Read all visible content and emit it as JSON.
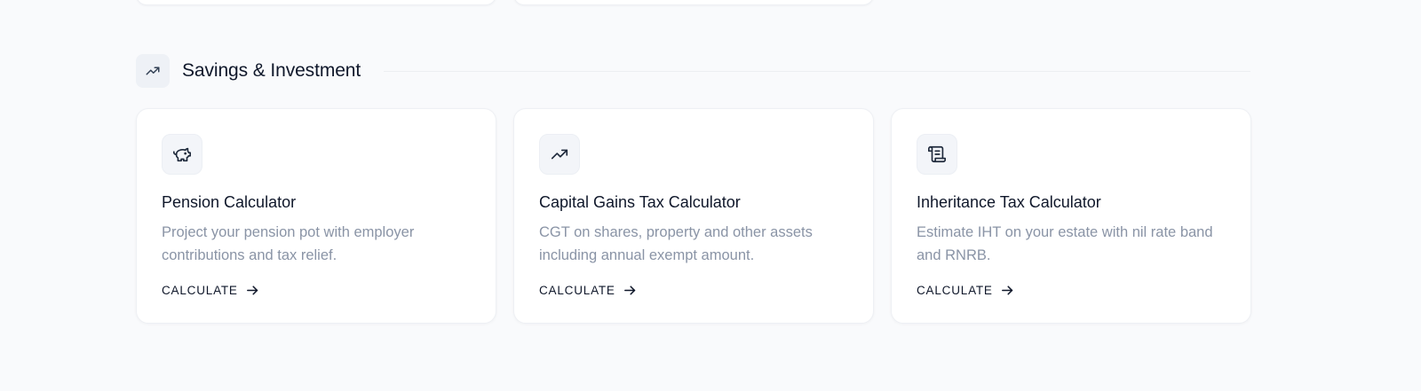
{
  "section": {
    "title": "Savings & Investment",
    "icon": "trending-up-icon"
  },
  "cards": [
    {
      "title": "Pension Calculator",
      "description": "Project your pension pot with employer contributions and tax relief.",
      "cta": "CALCULATE",
      "icon": "piggy-bank-icon"
    },
    {
      "title": "Capital Gains Tax Calculator",
      "description": "CGT on shares, property and other assets including annual exempt amount.",
      "cta": "CALCULATE",
      "icon": "trending-up-icon"
    },
    {
      "title": "Inheritance Tax Calculator",
      "description": "Estimate IHT on your estate with nil rate band and RNRB.",
      "cta": "CALCULATE",
      "icon": "scroll-icon"
    }
  ],
  "colors": {
    "background": "#f9fafc",
    "card": "#ffffff",
    "text": "#0f172a",
    "muted": "#8a94a6"
  }
}
